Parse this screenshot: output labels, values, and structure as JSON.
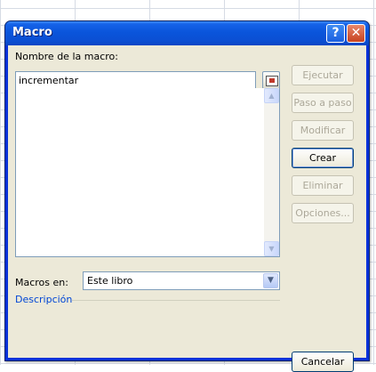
{
  "window": {
    "title": "Macro",
    "help_label": "?",
    "close_label": "✕"
  },
  "macro_name": {
    "label": "Nombre de la macro:",
    "value": "incrementar"
  },
  "buttons": {
    "run": "Ejecutar",
    "step_into": "Paso a paso",
    "edit": "Modificar",
    "create": "Crear",
    "delete": "Eliminar",
    "options": "Opciones...",
    "cancel": "Cancelar"
  },
  "macros_in": {
    "label": "Macros en:",
    "value": "Este libro"
  },
  "description": {
    "label": "Descripción"
  },
  "icons": {
    "reference": "collapse-dialog-icon",
    "scroll_up": "scroll-up-arrow-icon",
    "scroll_down": "scroll-down-arrow-icon",
    "dropdown": "chevron-down-icon"
  },
  "colors": {
    "titlebar": "#0a55db",
    "client_bg": "#ece9d8",
    "description_label": "#0046d5"
  }
}
